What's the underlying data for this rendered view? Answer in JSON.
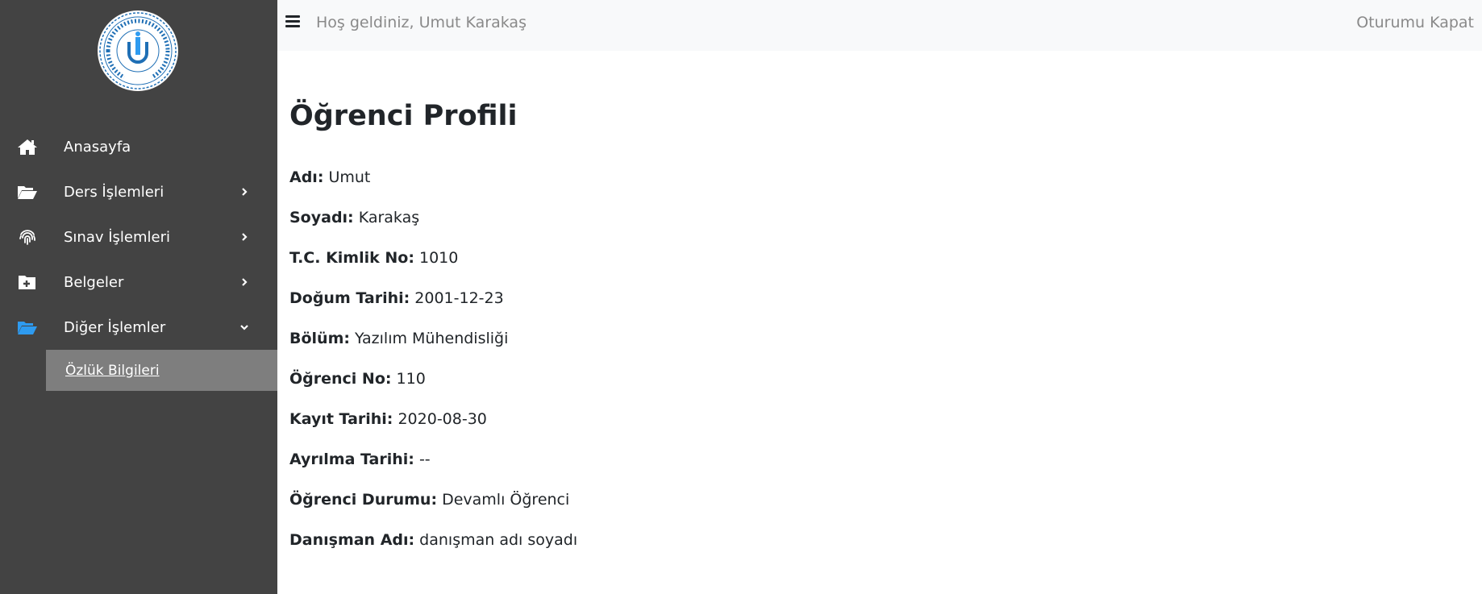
{
  "colors": {
    "sidebar_bg": "#434343",
    "subnav_active_bg": "#7e7e7e",
    "topbar_bg": "#f8f9fa",
    "active_icon": "#2e9bf0",
    "text_dark": "#212529",
    "text_muted": "#8a8a8a"
  },
  "logo": {
    "icon": "university-seal-logo",
    "text_ring": "BANDIRMA ONYEDİ EYLÜL ÜNİVERSİTESİ",
    "year": "2015"
  },
  "sidebar": {
    "items": [
      {
        "label": "Anasayfa",
        "icon": "home-icon",
        "chevron": ""
      },
      {
        "label": "Ders İşlemleri",
        "icon": "folder-open-icon",
        "chevron": "chevron-right-icon"
      },
      {
        "label": "Sınav İşlemleri",
        "icon": "fingerprint-icon",
        "chevron": "chevron-right-icon"
      },
      {
        "label": "Belgeler",
        "icon": "folder-plus-icon",
        "chevron": "chevron-right-icon"
      },
      {
        "label": "Diğer İşlemler",
        "icon": "folder-open-icon",
        "chevron": "chevron-down-icon"
      }
    ],
    "subitem": {
      "label": "Özlük Bilgileri"
    }
  },
  "topbar": {
    "menu_icon": "hamburger-icon",
    "welcome": "Hoş geldiniz, Umut Karakaş",
    "logout": "Oturumu Kapat"
  },
  "main": {
    "title": "Öğrenci Profili",
    "fields": [
      {
        "label": "Adı:",
        "value": "Umut"
      },
      {
        "label": "Soyadı:",
        "value": "Karakaş"
      },
      {
        "label": "T.C. Kimlik No:",
        "value": "1010"
      },
      {
        "label": "Doğum Tarihi:",
        "value": "2001-12-23"
      },
      {
        "label": "Bölüm:",
        "value": "Yazılım Mühendisliği"
      },
      {
        "label": "Öğrenci No:",
        "value": "110"
      },
      {
        "label": "Kayıt Tarihi:",
        "value": "2020-08-30"
      },
      {
        "label": "Ayrılma Tarihi:",
        "value": "--"
      },
      {
        "label": "Öğrenci Durumu:",
        "value": "Devamlı Öğrenci"
      },
      {
        "label": "Danışman Adı:",
        "value": "danışman adı soyadı"
      }
    ]
  }
}
